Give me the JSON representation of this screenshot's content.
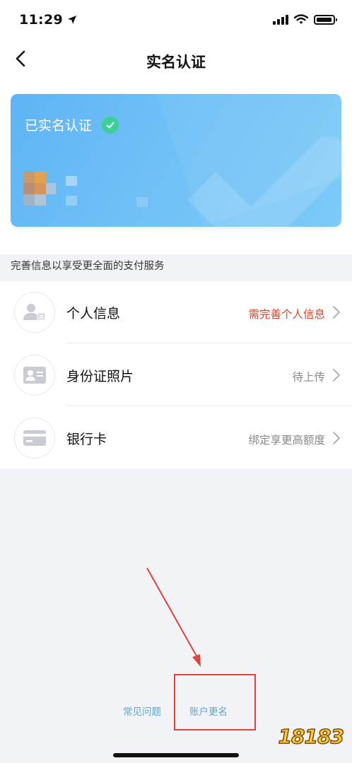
{
  "status_bar": {
    "time": "11:29",
    "icons": [
      "location-arrow-icon",
      "signal-icon",
      "wifi-icon",
      "battery-icon"
    ]
  },
  "nav": {
    "back_icon": "chevron-left-icon",
    "title": "实名认证"
  },
  "card": {
    "status_text": "已实名认证",
    "check_icon": "check-circle-icon",
    "masked_name": "pixelated-name",
    "background_color": "#6fc0f6",
    "check_color": "#3ccf96"
  },
  "hint": "完善信息以享受更全面的支付服务",
  "list": {
    "items": [
      {
        "icon": "person-id-icon",
        "label": "个人信息",
        "value": "需完善个人信息",
        "value_color": "#d8402c"
      },
      {
        "icon": "id-card-icon",
        "label": "身份证照片",
        "value": "待上传",
        "value_color": "#888888"
      },
      {
        "icon": "bank-card-icon",
        "label": "银行卡",
        "value": "绑定享更高额度",
        "value_color": "#888888"
      }
    ]
  },
  "footer": {
    "faq_label": "常见问题",
    "rename_label": "账户更名",
    "link_color": "#5fa6c8"
  },
  "annotation": {
    "highlight_color": "#e3413a"
  },
  "watermark": {
    "text": "18183"
  }
}
